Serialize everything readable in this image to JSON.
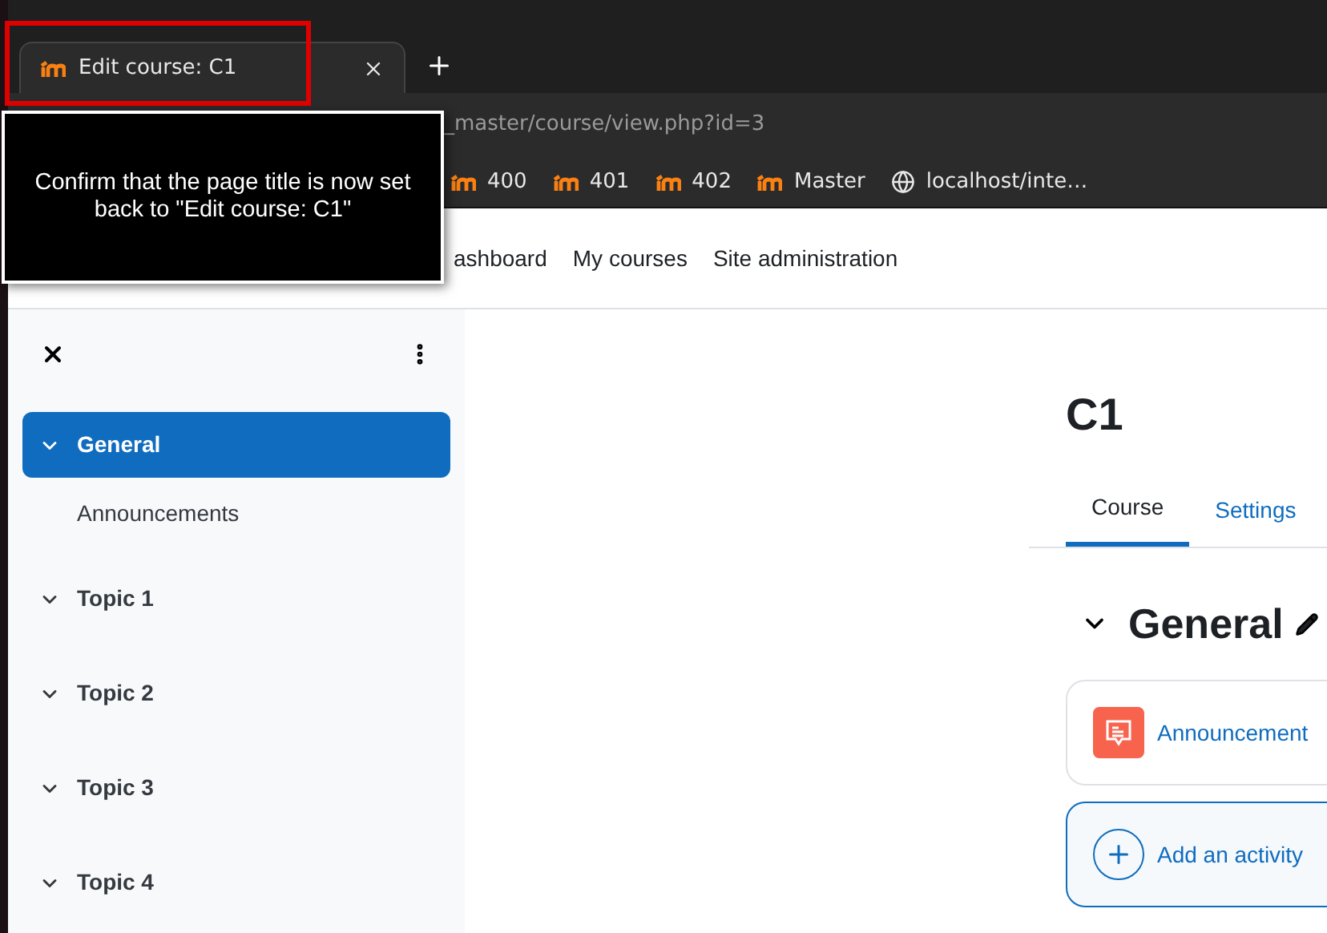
{
  "browser": {
    "tab": {
      "title": "Edit course: C1",
      "selected": true
    },
    "address": "_master/course/view.php?id=3",
    "bookmarks": [
      {
        "kind": "moodle",
        "label": "400"
      },
      {
        "kind": "moodle",
        "label": "401"
      },
      {
        "kind": "moodle",
        "label": "402"
      },
      {
        "kind": "moodle",
        "label": "Master"
      },
      {
        "kind": "globe",
        "label": "localhost/inte…"
      }
    ]
  },
  "tooltip": "Confirm that the page title is now set back to \"Edit course: C1\"",
  "nav": [
    "ashboard",
    "My courses",
    "Site administration"
  ],
  "sidebar": {
    "items": [
      {
        "label": "General",
        "selected": true,
        "expanded": true,
        "children": [
          {
            "label": "Announcements"
          }
        ]
      },
      {
        "label": "Topic 1",
        "selected": false,
        "expanded": true
      },
      {
        "label": "Topic 2",
        "selected": false,
        "expanded": true
      },
      {
        "label": "Topic 3",
        "selected": false,
        "expanded": true
      },
      {
        "label": "Topic 4",
        "selected": false,
        "expanded": true
      }
    ]
  },
  "course": {
    "title": "C1",
    "tabs": [
      {
        "label": "Course",
        "selected": true
      },
      {
        "label": "Settings",
        "selected": false
      }
    ],
    "section": {
      "title": "General",
      "expanded": true
    },
    "activities": [
      {
        "kind": "forum",
        "label": "Announcement"
      },
      {
        "kind": "add",
        "label": "Add an activity"
      }
    ]
  }
}
